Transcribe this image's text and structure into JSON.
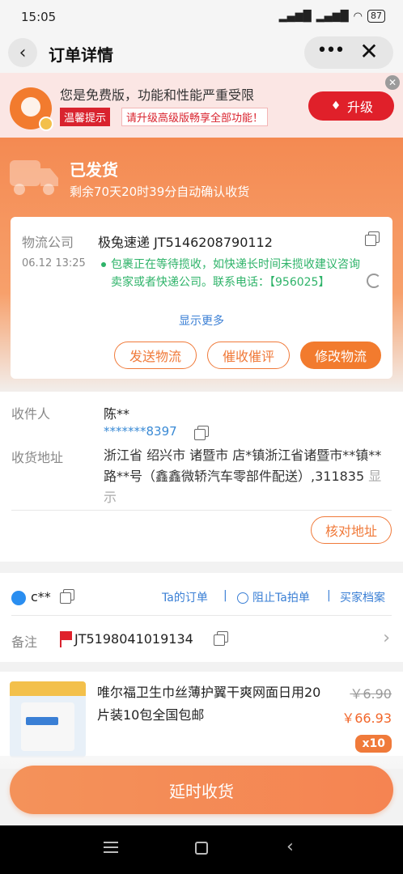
{
  "status_bar": {
    "time": "15:05",
    "battery": "87"
  },
  "header": {
    "title": "订单详情"
  },
  "promo": {
    "title": "您是免费版，功能和性能严重受限",
    "tag": "温馨提示",
    "subtitle": "请升级高级版畅享全部功能！",
    "upgrade_label": "升级"
  },
  "shipping": {
    "status": "已发货",
    "auto_confirm": "剩余70天20时39分自动确认收货"
  },
  "logistics": {
    "company_label": "物流公司",
    "company_value": "极兔速递 JT5146208790112",
    "time": "06.12 13:25",
    "message": "包裹正在等待揽收，如快递长时间未揽收建议咨询卖家或者快递公司。联系电话：【956025】",
    "show_more": "显示更多",
    "buttons": [
      "发送物流",
      "催收催评",
      "修改物流"
    ]
  },
  "receiver": {
    "name_label": "收件人",
    "name": "陈**",
    "phone": "*******8397",
    "address_label": "收货地址",
    "address": "浙江省 绍兴市 诸暨市 店*镇浙江省诸暨市**镇**路**号（鑫鑫微轿汽车零部件配送）,311835",
    "address_show": "显示",
    "check_label": "核对地址"
  },
  "buyer": {
    "name": "c**",
    "links": [
      "Ta的订单",
      "阻止Ta拍单",
      "买家档案"
    ],
    "note_label": "备注",
    "note_value": "JT5198041019134"
  },
  "product": {
    "title": "唯尔福卫生巾丝薄护翼干爽网面日用20片装10包全国包邮",
    "old_price": "￥6.90",
    "price": "￥66.93",
    "qty": "x10"
  },
  "bottom": {
    "delay_label": "延时收货"
  },
  "colors": {
    "accent": "#f27b2e",
    "link": "#3a7fd5",
    "green": "#2eb369",
    "red": "#e0202a"
  }
}
